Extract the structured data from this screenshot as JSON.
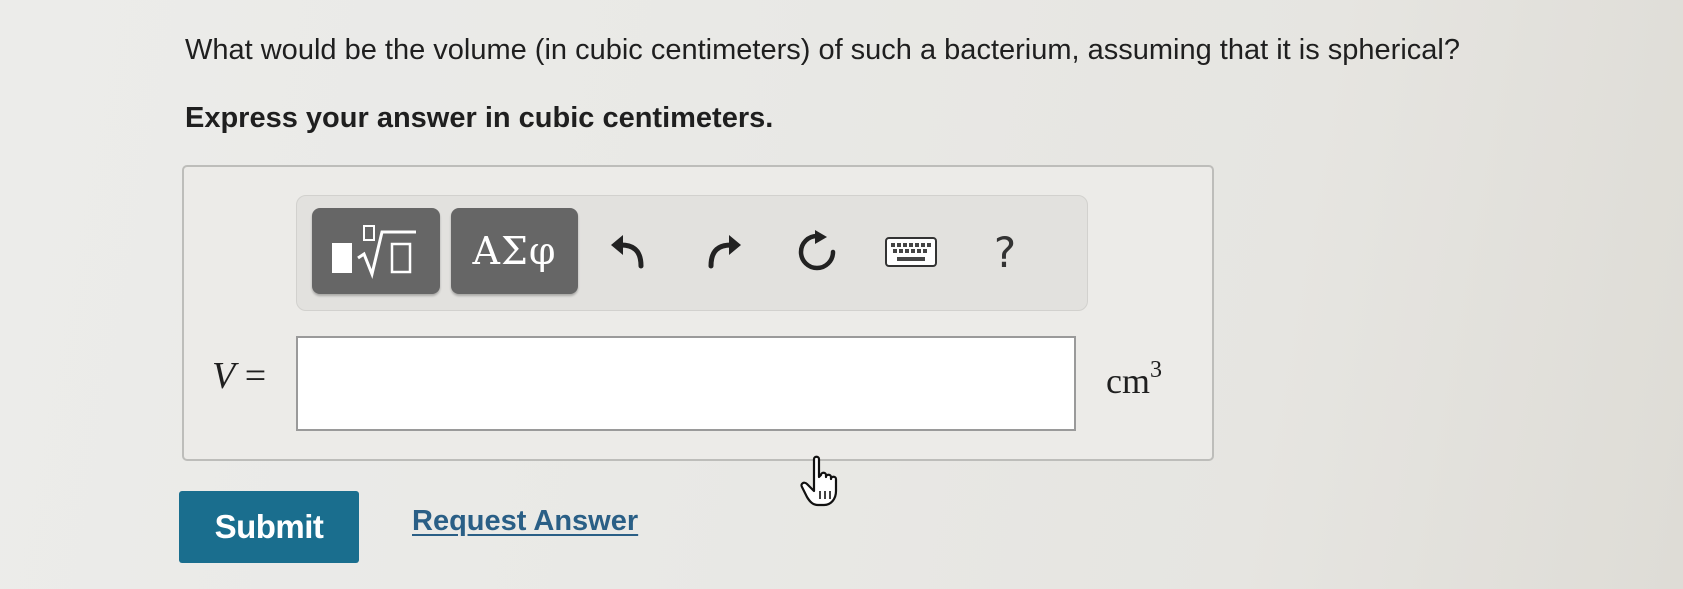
{
  "question": {
    "text": "What would be the volume (in cubic centimeters) of such a bacterium, assuming that it is spherical?",
    "instruction": "Express your answer in cubic centimeters."
  },
  "toolbar": {
    "symbols_label": "ΑΣφ",
    "help_label": "?",
    "icons": [
      "templates-icon",
      "undo-icon",
      "redo-icon",
      "reset-icon",
      "keyboard-icon",
      "help-icon"
    ]
  },
  "answer": {
    "variable": "V",
    "equals": "=",
    "value": "",
    "unit": "cm",
    "unit_exponent": "3"
  },
  "actions": {
    "submit_label": "Submit",
    "request_answer_label": "Request Answer"
  },
  "colors": {
    "submit_bg": "#1a6e8e",
    "link": "#2a5f86",
    "toolbar_button": "#666666"
  }
}
